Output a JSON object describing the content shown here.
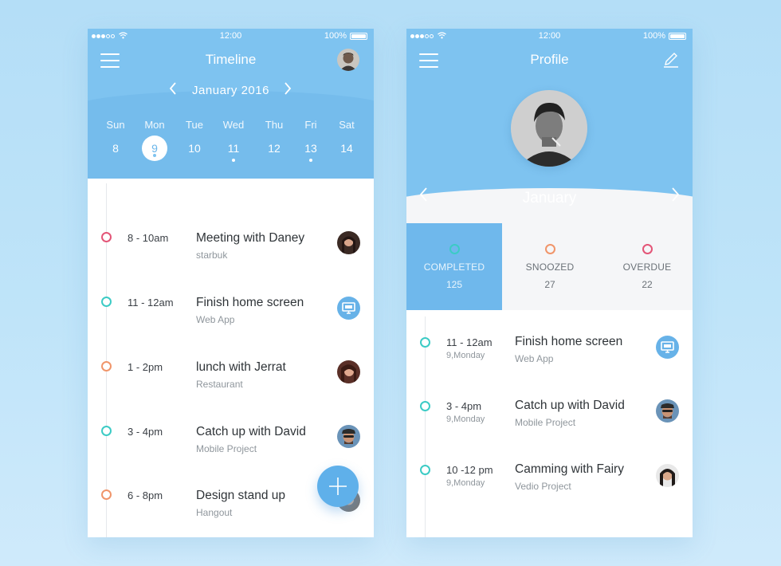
{
  "colors": {
    "accent": "#7ec3f0",
    "ring_red": "#e35577",
    "ring_teal": "#3ccbc5",
    "ring_orange": "#f0956a"
  },
  "left": {
    "status": {
      "time": "12:00",
      "battery": "100%"
    },
    "title": "Timeline",
    "month": "January  2016",
    "prev_icon": "chevron-left-icon",
    "next_icon": "chevron-right-icon",
    "days": [
      {
        "name": "Sun",
        "num": "8",
        "marker": false,
        "selected": false
      },
      {
        "name": "Mon",
        "num": "9",
        "marker": true,
        "selected": true
      },
      {
        "name": "Tue",
        "num": "10",
        "marker": false,
        "selected": false
      },
      {
        "name": "Wed",
        "num": "11",
        "marker": true,
        "selected": false
      },
      {
        "name": "Thu",
        "num": "12",
        "marker": false,
        "selected": false
      },
      {
        "name": "Fri",
        "num": "13",
        "marker": true,
        "selected": false
      },
      {
        "name": "Sat",
        "num": "14",
        "marker": false,
        "selected": false
      }
    ],
    "events": [
      {
        "time": "8 - 10am",
        "title": "Meeting with Daney",
        "subtitle": "starbuk",
        "ring": "red",
        "thumb": "avatar"
      },
      {
        "time": "11 - 12am",
        "title": "Finish home screen",
        "subtitle": "Web App",
        "ring": "teal",
        "thumb": "monitor-icon"
      },
      {
        "time": "1 - 2pm",
        "title": "lunch with Jerrat",
        "subtitle": "Restaurant",
        "ring": "orange",
        "thumb": "avatar"
      },
      {
        "time": "3 - 4pm",
        "title": "Catch up with David",
        "subtitle": "Mobile Project",
        "ring": "teal",
        "thumb": "avatar"
      },
      {
        "time": "6 - 8pm",
        "title": "Design stand up",
        "subtitle": "Hangout",
        "ring": "orange",
        "thumb": "avatar"
      }
    ],
    "fab_icon": "plus-icon"
  },
  "right": {
    "status": {
      "time": "12:00",
      "battery": "100%"
    },
    "title": "Profile",
    "edit_icon": "pencil-icon",
    "month": "January",
    "stats": [
      {
        "label": "COMPLETED",
        "count": "125",
        "ring": "teal",
        "active": true
      },
      {
        "label": "SNOOZED",
        "count": "27",
        "ring": "orange",
        "active": false
      },
      {
        "label": "OVERDUE",
        "count": "22",
        "ring": "red",
        "active": false
      }
    ],
    "events": [
      {
        "time": "11 - 12am",
        "date": "9,Monday",
        "title": "Finish home screen",
        "subtitle": "Web App",
        "ring": "teal",
        "thumb": "monitor-icon"
      },
      {
        "time": "3 - 4pm",
        "date": "9,Monday",
        "title": "Catch up with David",
        "subtitle": "Mobile Project",
        "ring": "teal",
        "thumb": "avatar"
      },
      {
        "time": "10 -12 pm",
        "date": "9,Monday",
        "title": "Camming with Fairy",
        "subtitle": "Vedio Project",
        "ring": "teal",
        "thumb": "avatar"
      }
    ]
  }
}
